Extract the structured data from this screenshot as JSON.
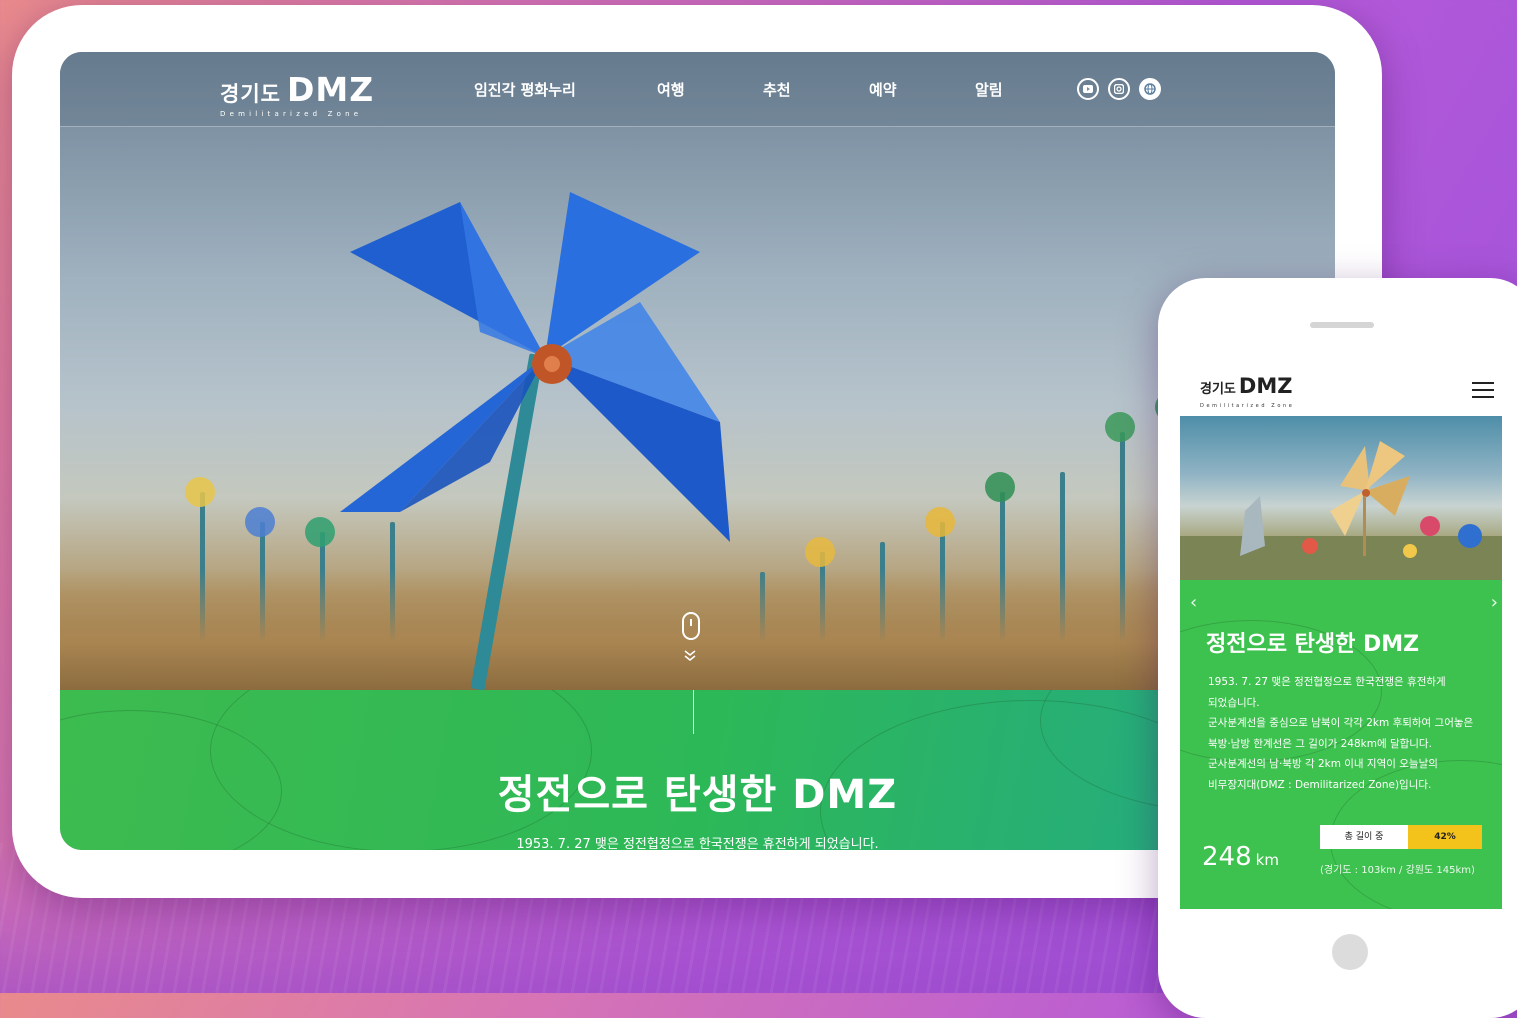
{
  "tablet": {
    "logo": {
      "ko": "경기도",
      "en": "DMZ",
      "sub": "Demilitarized Zone"
    },
    "nav": [
      "임진각 평화누리",
      "여행",
      "추천",
      "예약",
      "알림"
    ],
    "sns_icons": [
      "youtube-icon",
      "instagram-icon",
      "language-icon"
    ],
    "hero_title": "정전으로 탄생한 DMZ",
    "hero_desc": "1953. 7. 27 맺은 정전협정으로 한국전쟁은 휴전하게 되었습니다."
  },
  "phone": {
    "logo": {
      "ko": "경기도",
      "en": "DMZ",
      "sub": "Demilitarized Zone"
    },
    "title": "정전으로 탄생한 DMZ",
    "lines": [
      "1953. 7. 27 맺은 정전협정으로 한국전쟁은 휴전하게",
      "되었습니다.",
      "군사분계선을 중심으로 남북이 각각 2km 후퇴하여 그어놓은",
      "북방·남방 한계선은 그 길이가 248km에 달합니다.",
      "군사분계선의 남·북방 각 2km 이내 지역이 오늘날의",
      "비무장지대(DMZ : Demilitarized Zone)입니다."
    ],
    "progress_label": "총 길이 중",
    "progress_value": "42%",
    "progress_fraction": 0.42,
    "km_number": "248",
    "km_unit": "km",
    "breakdown": "(경기도 : 103km / 강원도 145km)"
  },
  "colors": {
    "green": "#3ec24f",
    "teal": "#23a98a",
    "yellow": "#f3c21b"
  }
}
